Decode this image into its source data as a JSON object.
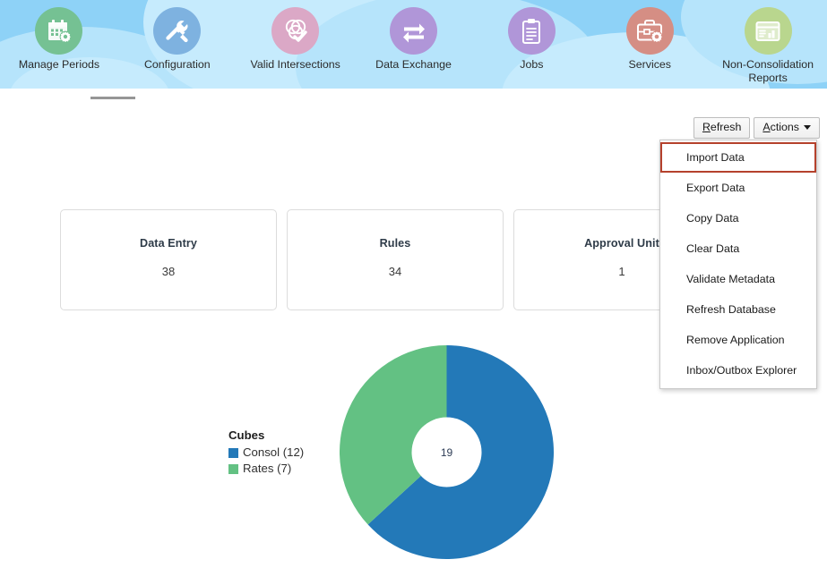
{
  "header": {
    "background_color": "#8ed2f7",
    "nav_items": [
      {
        "label": "Manage Periods",
        "icon": "calendar-gear-icon",
        "icon_color": "#75c193"
      },
      {
        "label": "Configuration",
        "icon": "wrench-hammer-icon",
        "icon_color": "#7eb2e0"
      },
      {
        "label": "Valid Intersections",
        "icon": "venn-check-icon",
        "icon_color": "#dba8c6"
      },
      {
        "label": "Data Exchange",
        "icon": "exchange-arrows-icon",
        "icon_color": "#b096d8"
      },
      {
        "label": "Jobs",
        "icon": "clipboard-icon",
        "icon_color": "#b096d8"
      },
      {
        "label": "Services",
        "icon": "briefcase-gear-icon",
        "icon_color": "#d58e84"
      },
      {
        "label": "Non-Consolidation Reports",
        "icon": "report-chart-icon",
        "icon_color": "#b9d68e"
      }
    ]
  },
  "toolbar": {
    "refresh_label": "Refresh",
    "refresh_accesskey": "R",
    "actions_label": "Actions",
    "actions_accesskey": "A"
  },
  "actions_menu": {
    "open": true,
    "focused_index": 0,
    "focus_border_color": "#b5412c",
    "items": [
      {
        "label": "Import Data"
      },
      {
        "label": "Export Data"
      },
      {
        "label": "Copy Data"
      },
      {
        "label": "Clear Data"
      },
      {
        "label": "Validate Metadata"
      },
      {
        "label": "Refresh Database"
      },
      {
        "label": "Remove Application"
      },
      {
        "label": "Inbox/Outbox Explorer"
      }
    ]
  },
  "cards": [
    {
      "title": "Data Entry",
      "value": "38"
    },
    {
      "title": "Rules",
      "value": "34"
    },
    {
      "title": "Approval Unit",
      "value": "1"
    }
  ],
  "chart_data": {
    "type": "pie",
    "title": "Cubes",
    "donut": true,
    "center_label": "19",
    "total": 19,
    "legend_position": "left",
    "categories": [
      "Consol",
      "Rates"
    ],
    "values": [
      12,
      7
    ],
    "labels": [
      "Consol (12)",
      "Rates (7)"
    ],
    "colors": [
      "#2379b8",
      "#63c183"
    ],
    "series": [
      {
        "name": "Consol",
        "value": 12,
        "color": "#2379b8",
        "label": "Consol (12)"
      },
      {
        "name": "Rates",
        "value": 7,
        "color": "#63c183",
        "label": "Rates (7)"
      }
    ]
  }
}
